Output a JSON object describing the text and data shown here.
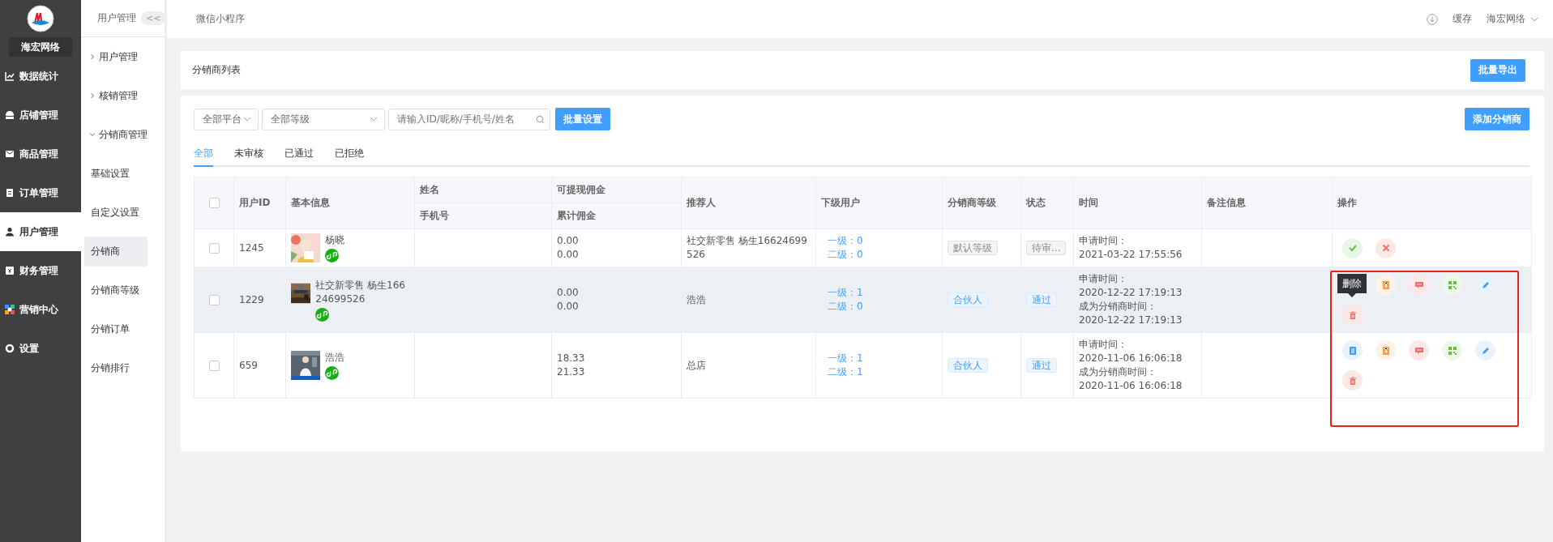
{
  "sidebar": {
    "brand": "海宏网络",
    "items": [
      {
        "label": "数据统计",
        "selected": false
      },
      {
        "label": "店铺管理",
        "selected": false
      },
      {
        "label": "商品管理",
        "selected": false
      },
      {
        "label": "订单管理",
        "selected": false
      },
      {
        "label": "用户管理",
        "selected": true
      },
      {
        "label": "财务管理",
        "selected": false
      },
      {
        "label": "营销中心",
        "selected": false
      },
      {
        "label": "设置",
        "selected": false
      }
    ]
  },
  "subnav": {
    "title": "用户管理",
    "collapse": "<<",
    "items": [
      {
        "label": "用户管理",
        "kind": "group",
        "expanded": false
      },
      {
        "label": "核销管理",
        "kind": "group",
        "expanded": false
      },
      {
        "label": "分销商管理",
        "kind": "group",
        "expanded": true
      },
      {
        "label": "基础设置",
        "kind": "link",
        "selected": false
      },
      {
        "label": "自定义设置",
        "kind": "link",
        "selected": false
      },
      {
        "label": "分销商",
        "kind": "link",
        "selected": true
      },
      {
        "label": "分销商等级",
        "kind": "link",
        "selected": false
      },
      {
        "label": "分销订单",
        "kind": "link",
        "selected": false
      },
      {
        "label": "分销排行",
        "kind": "link",
        "selected": false
      }
    ]
  },
  "header": {
    "title": "微信小程序",
    "cache": "缓存",
    "account": "海宏网络"
  },
  "list_card": {
    "title": "分销商列表",
    "export_button": "批量导出"
  },
  "filters": {
    "platform": "全部平台",
    "level": "全部等级",
    "search_placeholder": "请输入ID/昵称/手机号/姓名",
    "batch_button": "批量设置",
    "add_button": "添加分销商"
  },
  "tabs": [
    {
      "label": "全部",
      "selected": true
    },
    {
      "label": "未审核",
      "selected": false
    },
    {
      "label": "已通过",
      "selected": false
    },
    {
      "label": "已拒绝",
      "selected": false
    }
  ],
  "table": {
    "header_checked": false,
    "columns": [
      "用户ID",
      "基本信息",
      "姓名",
      "手机号",
      "可提现佣金",
      "累计佣金",
      "推荐人",
      "下级用户",
      "分销商等级",
      "状态",
      "时间",
      "备注信息",
      "操作"
    ],
    "rows": [
      {
        "checked": false,
        "highlighted": false,
        "id": "1245",
        "nickname": "杨晓",
        "withdrawable": "0.00",
        "total": "0.00",
        "referrer": "社交新零售 杨生16624699526",
        "level1": "一级：0",
        "level2": "二级：0",
        "level": {
          "label": "默认等级",
          "kind": "default"
        },
        "status": {
          "label": "待审...",
          "kind": "pending"
        },
        "times": [
          "申请时间：",
          "2021-03-22 17:55:56"
        ],
        "actions": [
          {
            "kind": "approve"
          },
          {
            "kind": "reject"
          }
        ]
      },
      {
        "checked": false,
        "highlighted": true,
        "id": "1229",
        "nickname": "社交新零售 杨生16624699526",
        "withdrawable": "0.00",
        "total": "0.00",
        "referrer": "浩浩",
        "level1": "一级：1",
        "level2": "二级：0",
        "level": {
          "label": "合伙人",
          "kind": "partner"
        },
        "status": {
          "label": "通过",
          "kind": "approved"
        },
        "times": [
          "申请时间：",
          "2020-12-22 17:19:13",
          "成为分销商时间：",
          "2020-12-22 17:19:13"
        ],
        "actions": [
          {
            "kind": "tooltip",
            "text": "删除"
          },
          {
            "kind": "commission"
          },
          {
            "kind": "message"
          },
          {
            "kind": "qrcode"
          },
          {
            "kind": "edit"
          },
          {
            "kind": "delete"
          }
        ]
      },
      {
        "checked": false,
        "highlighted": false,
        "id": "659",
        "nickname": "浩浩",
        "withdrawable": "18.33",
        "total": "21.33",
        "referrer": "总店",
        "level1": "一级：1",
        "level2": "二级：1",
        "level": {
          "label": "合伙人",
          "kind": "partner"
        },
        "status": {
          "label": "通过",
          "kind": "approved"
        },
        "times": [
          "申请时间：",
          "2020-11-06 16:06:18",
          "成为分销商时间：",
          "2020-11-06 16:06:18"
        ],
        "actions": [
          {
            "kind": "detail"
          },
          {
            "kind": "commission"
          },
          {
            "kind": "message"
          },
          {
            "kind": "qrcode"
          },
          {
            "kind": "edit"
          },
          {
            "kind": "delete"
          }
        ]
      }
    ]
  }
}
